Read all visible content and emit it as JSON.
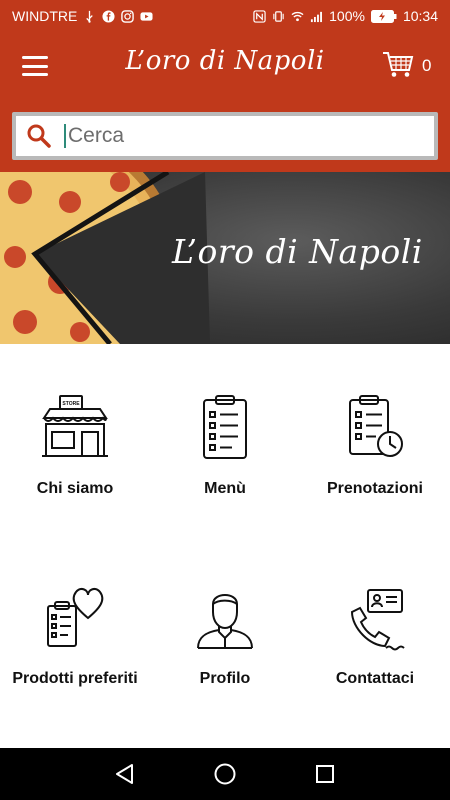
{
  "status_bar": {
    "carrier": "WINDTRE",
    "battery": "100%",
    "time": "10:34"
  },
  "header": {
    "logo_text": "L’oro di Napoli",
    "cart_count": "0"
  },
  "search": {
    "placeholder": "Cerca"
  },
  "banner": {
    "title": "L’oro di Napoli"
  },
  "menu": [
    {
      "label": "Chi siamo",
      "icon": "store-icon"
    },
    {
      "label": "Menù",
      "icon": "checklist-icon"
    },
    {
      "label": "Prenotazioni",
      "icon": "checklist-clock-icon"
    },
    {
      "label": "Prodotti preferiti",
      "icon": "checklist-heart-icon"
    },
    {
      "label": "Profilo",
      "icon": "user-icon"
    },
    {
      "label": "Contattaci",
      "icon": "phone-contact-icon"
    }
  ],
  "colors": {
    "brand": "#c0391b",
    "navbar": "#000000"
  }
}
